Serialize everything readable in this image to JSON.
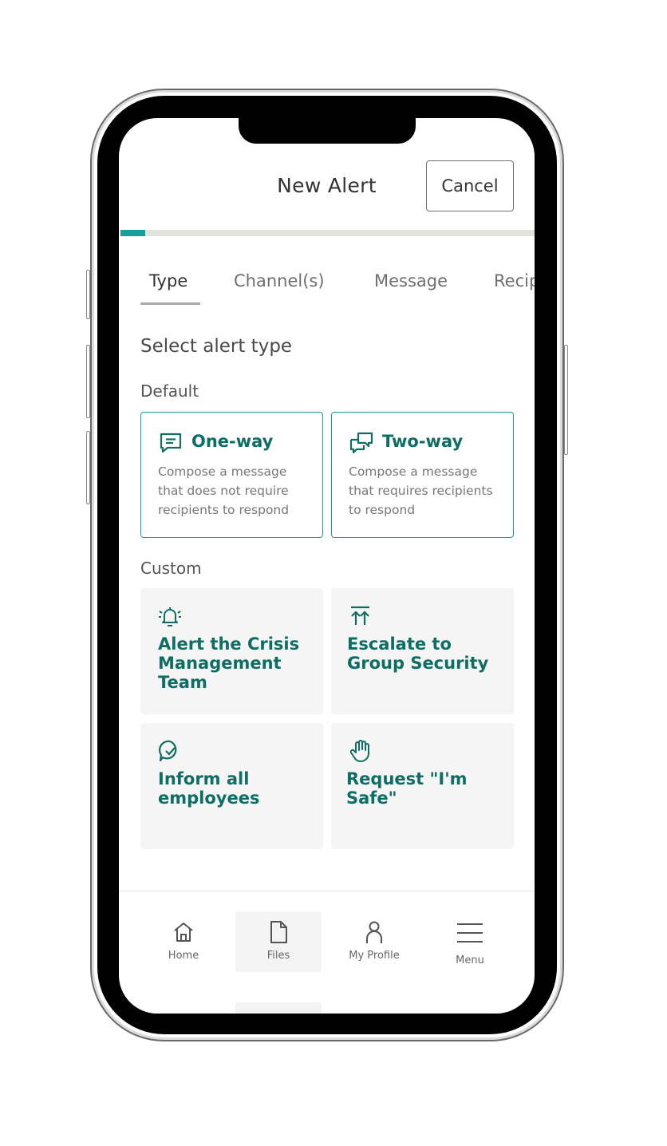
{
  "header": {
    "title": "New Alert",
    "cancel_label": "Cancel"
  },
  "progress": {
    "value": 0.06
  },
  "tabs": [
    {
      "label": "Type",
      "active": true
    },
    {
      "label": "Channel(s)",
      "active": false
    },
    {
      "label": "Message",
      "active": false
    },
    {
      "label": "Recip",
      "active": false
    }
  ],
  "section_title": "Select alert type",
  "default_group": {
    "label": "Default",
    "cards": [
      {
        "title": "One-way",
        "description": "Compose a message that does not require recipients to respond",
        "icon": "message-icon"
      },
      {
        "title": "Two-way",
        "description": "Compose a message that requires recipients to respond",
        "icon": "two-way-message-icon"
      }
    ]
  },
  "custom_group": {
    "label": "Custom",
    "cards": [
      {
        "title": "Alert the Crisis Management Team",
        "icon": "bell-ringing-icon"
      },
      {
        "title": "Escalate to Group Security",
        "icon": "escalate-arrows-icon"
      },
      {
        "title": "Inform all employees",
        "icon": "chat-check-icon"
      },
      {
        "title": "Request \"I'm Safe\"",
        "icon": "hand-icon"
      }
    ]
  },
  "bottom_nav": [
    {
      "label": "Home",
      "icon": "home-icon",
      "active": false
    },
    {
      "label": "Files",
      "icon": "file-icon",
      "active": true
    },
    {
      "label": "My Profile",
      "icon": "user-icon",
      "active": false
    },
    {
      "label": "Menu",
      "icon": "menu-icon",
      "active": false
    }
  ],
  "colors": {
    "accent": "#17a098",
    "accent_text": "#0e6e64",
    "card_bg": "#f5f5f5"
  }
}
